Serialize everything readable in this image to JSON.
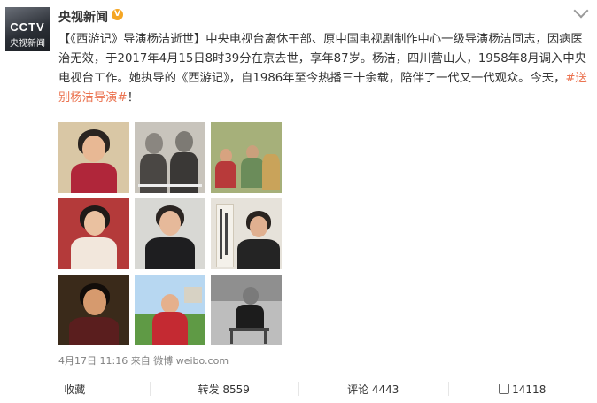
{
  "account": {
    "name": "央视新闻",
    "avatar_text_top": "CCTV",
    "avatar_text_bottom": "央视新闻",
    "verified_badge": "V"
  },
  "post": {
    "text_before_tag": "【《西游记》导演杨洁逝世】中央电视台离休干部、原中国电视剧制作中心一级导演杨洁同志，因病医治无效，于2017年4月15日8时39分在京去世，享年87岁。杨洁，四川营山人，1958年8月调入中央电视台工作。她执导的《西游记》，自1986年至今热播三十余载，陪伴了一代又一代观众。今天，",
    "hashtag": "#送别杨洁导演#",
    "text_after_tag": "！"
  },
  "photos": [
    {
      "id": "photo-1",
      "bg": "#d9c7a5",
      "tone": "color"
    },
    {
      "id": "photo-2",
      "bg": "#c8c4bc",
      "tone": "bw"
    },
    {
      "id": "photo-3",
      "bg": "#a6b07a",
      "tone": "color"
    },
    {
      "id": "photo-4",
      "bg": "#b43a3a",
      "tone": "color"
    },
    {
      "id": "photo-5",
      "bg": "#d8d8d4",
      "tone": "color"
    },
    {
      "id": "photo-6",
      "bg": "#e6e2da",
      "tone": "color"
    },
    {
      "id": "photo-7",
      "bg": "#3a2a1a",
      "tone": "color"
    },
    {
      "id": "photo-8",
      "bg": "#b7d7f1",
      "tone": "color"
    },
    {
      "id": "photo-9",
      "bg": "#bdbdbd",
      "tone": "bw"
    }
  ],
  "meta": {
    "time": "4月17日 11:16",
    "from_label": "来自",
    "source": "微博 weibo.com"
  },
  "actions": {
    "favorite": "收藏",
    "repost": "转发 8559",
    "comment": "评论 4443",
    "like": "14118"
  },
  "colors": {
    "hashtag": "#eb7350",
    "badge": "#f5a623",
    "meta": "#808080"
  },
  "icons": [
    "chevron-down-icon",
    "verified-icon",
    "thumbs-up-icon"
  ]
}
